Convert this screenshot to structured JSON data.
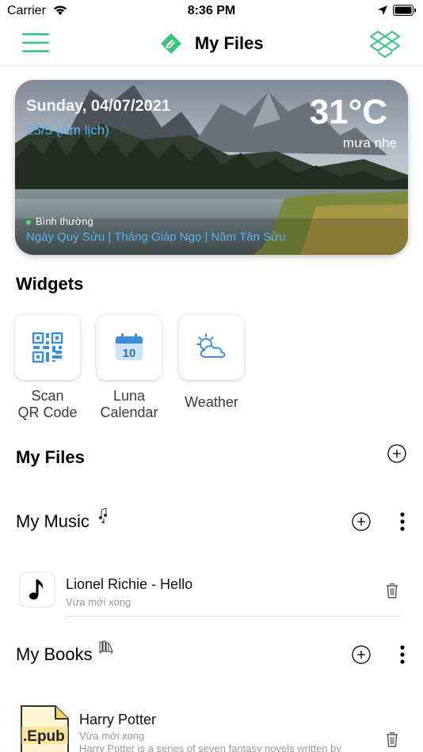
{
  "status": {
    "carrier": "Carrier",
    "time": "8:36 PM"
  },
  "nav": {
    "title": "My Files",
    "brand_color": "#37c47e"
  },
  "hero": {
    "date": "Sunday, 04/07/2021",
    "lunar": "25/5 (Âm lịch)",
    "temperature": "31°C",
    "condition": "mưa nhẹ",
    "status": "Bình thường",
    "ganzhi": "Ngày Quý Sửu | Tháng Giáp Ngọ | Năm Tân Sửu"
  },
  "widgets": {
    "title": "Widgets",
    "items": [
      {
        "line1": "Scan",
        "line2": "QR Code",
        "icon": "qr-code-icon"
      },
      {
        "line1": "Luna",
        "line2": "Calendar",
        "icon": "calendar-icon",
        "day": "10"
      },
      {
        "line1": "Weather",
        "line2": "",
        "icon": "weather-icon"
      }
    ]
  },
  "my_files": {
    "title": "My Files"
  },
  "music": {
    "title": "My Music",
    "files": [
      {
        "name": "Lionel Richie - Hello",
        "time": "Vừa mới xong"
      }
    ]
  },
  "books": {
    "title": "My Books",
    "files": [
      {
        "name": "Harry Potter",
        "time": "Vừa mới xong",
        "badge": ".Epub",
        "description": "Harry Potter is a series of seven fantasy novels written by"
      }
    ]
  }
}
